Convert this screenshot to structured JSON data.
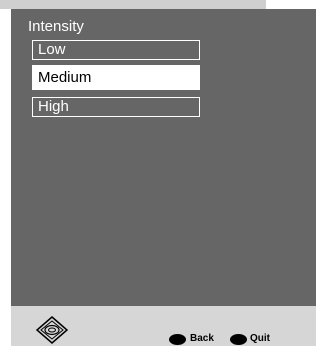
{
  "menu": {
    "title": "Intensity",
    "options": [
      {
        "label": "Low",
        "selected": false
      },
      {
        "label": "Medium",
        "selected": true
      },
      {
        "label": "High",
        "selected": false
      }
    ]
  },
  "footer": {
    "nav_icon": "directional-pad-icon",
    "back_label": "Back",
    "quit_label": "Quit"
  },
  "colors": {
    "panel": "#666666",
    "footer": "#d6d6d6",
    "highlight": "#ffffff",
    "text": "#ffffff"
  }
}
